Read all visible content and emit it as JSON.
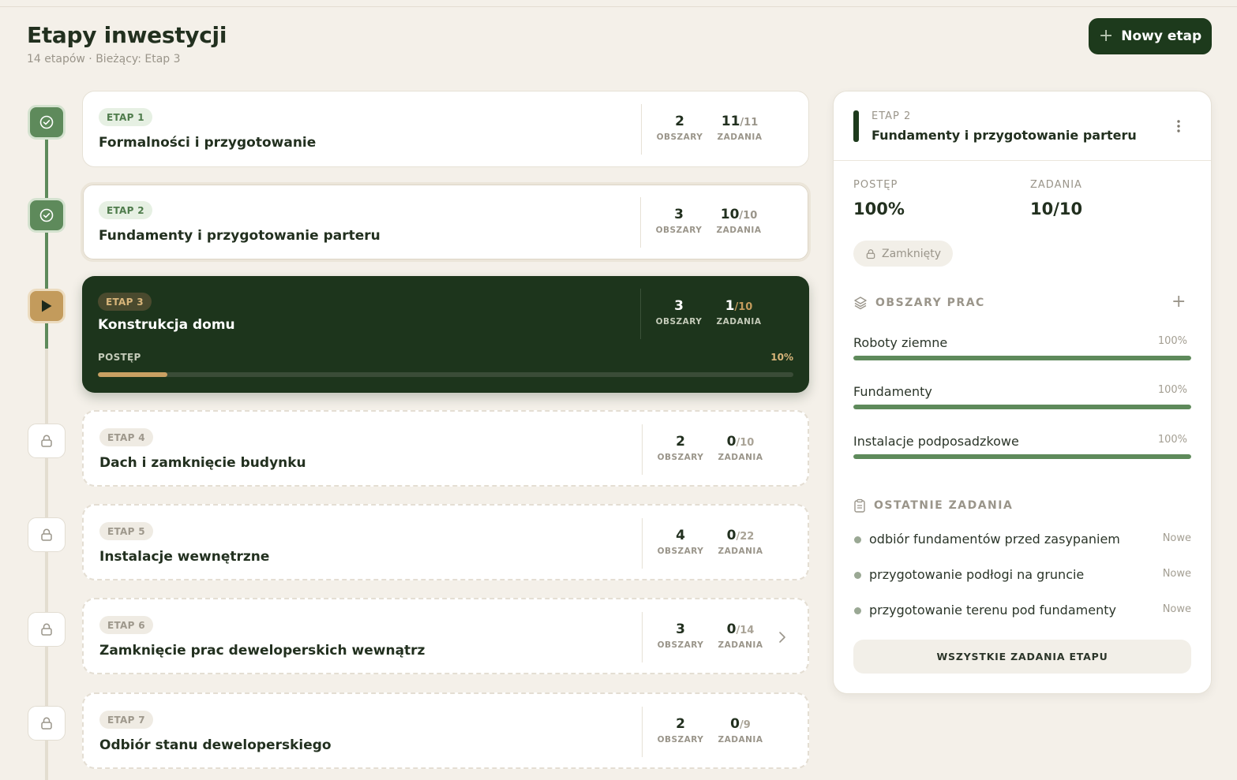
{
  "header": {
    "title": "Etapy inwestycji",
    "subtitle": "14 etapów · Bieżący: Etap 3",
    "new_button": "Nowy etap"
  },
  "stages": [
    {
      "badge": "ETAP 1",
      "title": "Formalności i przygotowanie",
      "areas": "2",
      "areas_label": "OBSZARY",
      "tasks_done": "11",
      "tasks_total": "/11",
      "tasks_label": "ZADANIA",
      "state": "done"
    },
    {
      "badge": "ETAP 2",
      "title": "Fundamenty i przygotowanie parteru",
      "areas": "3",
      "areas_label": "OBSZARY",
      "tasks_done": "10",
      "tasks_total": "/10",
      "tasks_label": "ZADANIA",
      "state": "done"
    },
    {
      "badge": "ETAP 3",
      "title": "Konstrukcja domu",
      "areas": "3",
      "areas_label": "OBSZARY",
      "tasks_done": "1",
      "tasks_total": "/10",
      "tasks_label": "ZADANIA",
      "state": "active",
      "progress_label": "POSTĘP",
      "progress_text": "10%",
      "progress_value": 10
    },
    {
      "badge": "ETAP 4",
      "title": "Dach i zamknięcie budynku",
      "areas": "2",
      "areas_label": "OBSZARY",
      "tasks_done": "0",
      "tasks_total": "/10",
      "tasks_label": "ZADANIA",
      "state": "locked"
    },
    {
      "badge": "ETAP 5",
      "title": "Instalacje wewnętrzne",
      "areas": "4",
      "areas_label": "OBSZARY",
      "tasks_done": "0",
      "tasks_total": "/22",
      "tasks_label": "ZADANIA",
      "state": "locked"
    },
    {
      "badge": "ETAP 6",
      "title": "Zamknięcie prac deweloperskich wewnątrz",
      "areas": "3",
      "areas_label": "OBSZARY",
      "tasks_done": "0",
      "tasks_total": "/14",
      "tasks_label": "ZADANIA",
      "state": "locked"
    },
    {
      "badge": "ETAP 7",
      "title": "Odbiór stanu deweloperskiego",
      "areas": "2",
      "areas_label": "OBSZARY",
      "tasks_done": "0",
      "tasks_total": "/9",
      "tasks_label": "ZADANIA",
      "state": "locked"
    }
  ],
  "panel": {
    "kicker": "ETAP 2",
    "title": "Fundamenty i przygotowanie parteru",
    "progress_label": "POSTĘP",
    "progress_value": "100%",
    "tasks_label": "ZADANIA",
    "tasks_value": "10/10",
    "status": "Zamknięty",
    "areas_heading": "OBSZARY PRAC",
    "areas": [
      {
        "name": "Roboty ziemne",
        "pct_text": "100%",
        "pct": 100
      },
      {
        "name": "Fundamenty",
        "pct_text": "100%",
        "pct": 100
      },
      {
        "name": "Instalacje podposadzkowe",
        "pct_text": "100%",
        "pct": 100
      }
    ],
    "tasks_heading": "OSTATNIE ZADANIA",
    "tasks": [
      {
        "name": "odbiór fundamentów przed zasypaniem",
        "status": "Nowe"
      },
      {
        "name": "przygotowanie podłogi na gruncie",
        "status": "Nowe"
      },
      {
        "name": "przygotowanie terenu pod fundamenty",
        "status": "Nowe"
      }
    ],
    "all_tasks_button": "WSZYSTKIE ZADANIA ETAPU"
  },
  "colors": {
    "background": "#f4f0e9",
    "primary_dark": "#1d3a1c",
    "done_green": "#5e8a5b",
    "active_gold": "#c39b5c"
  },
  "icons": {
    "done": "check-circle-icon",
    "active": "play-icon",
    "locked": "lock-icon"
  }
}
